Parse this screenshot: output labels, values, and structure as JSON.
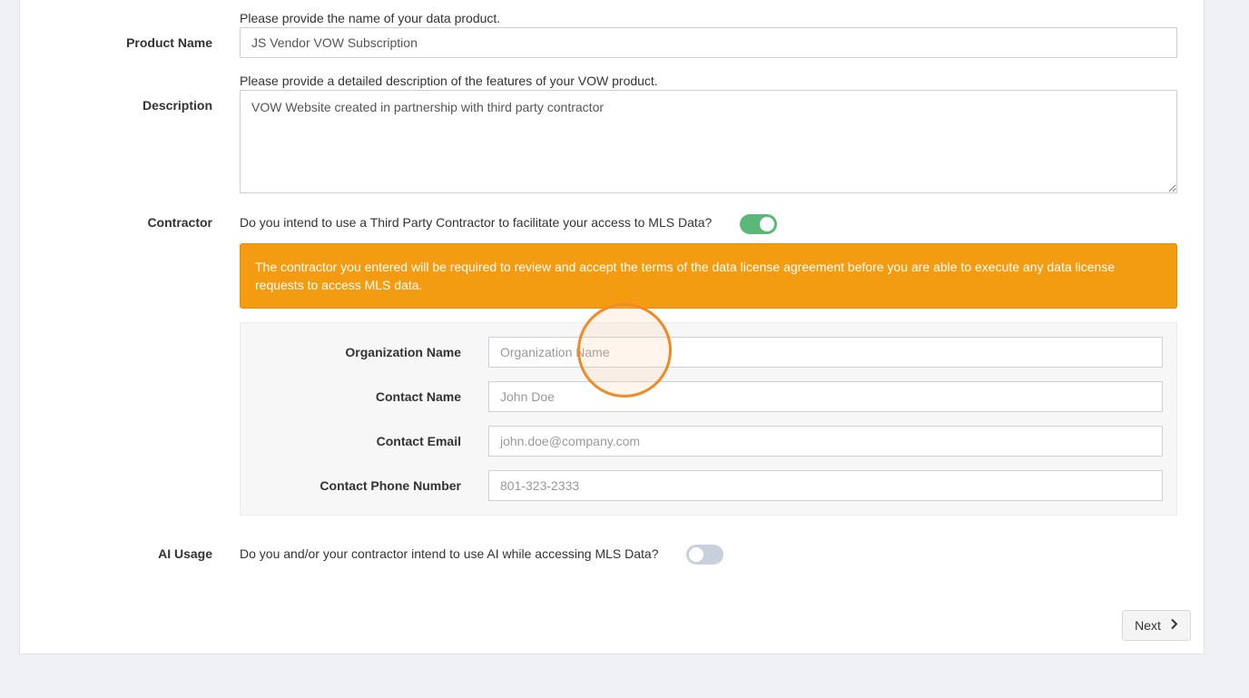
{
  "product_name": {
    "label": "Product Name",
    "hint": "Please provide the name of your data product.",
    "value": "JS Vendor VOW Subscription"
  },
  "description": {
    "label": "Description",
    "hint": "Please provide a detailed description of the features of your VOW product.",
    "value": "VOW Website created in partnership with third party contractor"
  },
  "contractor": {
    "label": "Contractor",
    "question": "Do you intend to use a Third Party Contractor to facilitate your access to MLS Data?",
    "toggle_on": true,
    "toggle_color": "#5cb878",
    "alert_text": "The contractor you entered will be required to review and accept the terms of the data license agreement before you are able to execute any data license requests to access MLS data.",
    "alert_color": "#f39c12",
    "organization_name": {
      "label": "Organization Name",
      "placeholder": "Organization Name"
    },
    "contact_name": {
      "label": "Contact Name",
      "placeholder": "John Doe"
    },
    "contact_email": {
      "label": "Contact Email",
      "placeholder": "john.doe@company.com"
    },
    "contact_phone": {
      "label": "Contact Phone Number",
      "placeholder": "801-323-2333"
    }
  },
  "ai_usage": {
    "label": "AI Usage",
    "question": "Do you and/or your contractor intend to use AI while accessing MLS Data?",
    "toggle_on": false
  },
  "footer": {
    "next_label": "Next",
    "next_icon": "chevron-right-icon"
  }
}
